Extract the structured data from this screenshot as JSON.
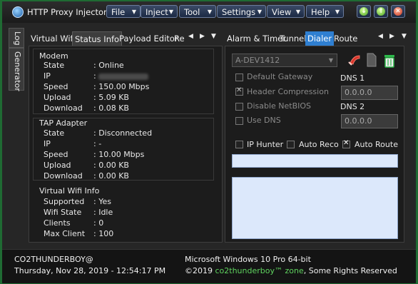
{
  "app": {
    "title": "HTTP Proxy Injector"
  },
  "menu": {
    "file": "File",
    "inject": "Inject",
    "tool": "Tool",
    "settings": "Settings",
    "view": "View",
    "help": "Help"
  },
  "window_buttons": [
    "down-arrow-icon",
    "up-arrow-icon",
    "close-icon"
  ],
  "side_tabs": [
    "Log",
    "Generator"
  ],
  "left_tabs": [
    "Virtual Wifi",
    "Status Info",
    "Payload Editor",
    "Rep"
  ],
  "right_tabs": [
    "Alarm & Timer",
    "Tunnel",
    "Dialer",
    "Route"
  ],
  "status": {
    "modem": {
      "title": "Modem",
      "rows": [
        {
          "label": "State",
          "value": ": Online"
        },
        {
          "label": "IP",
          "value": ":"
        },
        {
          "label": "Speed",
          "value": ": 150.00 Mbps"
        },
        {
          "label": "Upload",
          "value": ": 5.09 KB"
        },
        {
          "label": "Download",
          "value": ": 0.08 KB"
        }
      ]
    },
    "tap": {
      "title": "TAP Adapter",
      "rows": [
        {
          "label": "State",
          "value": ": Disconnected"
        },
        {
          "label": "IP",
          "value": ": -"
        },
        {
          "label": "Speed",
          "value": ": 10.00 Mbps"
        },
        {
          "label": "Upload",
          "value": ": 0.00 KB"
        },
        {
          "label": "Download",
          "value": ": 0.00 KB"
        }
      ]
    },
    "wifi": {
      "title": "Virtual Wifi Info",
      "rows": [
        {
          "label": "Supported",
          "value": ": Yes"
        },
        {
          "label": "Wifi State",
          "value": ": Idle"
        },
        {
          "label": "Clients",
          "value": ": 0"
        },
        {
          "label": "Max Client",
          "value": ": 100"
        }
      ]
    }
  },
  "dialer": {
    "device": "A-DEV1412",
    "default_gateway": "Default Gateway",
    "header_compression": "Header Compression",
    "disable_netbios": "Disable NetBIOS",
    "use_dns": "Use DNS",
    "dns1_label": "DNS 1",
    "dns1_value": "0.0.0.0",
    "dns2_label": "DNS 2",
    "dns2_value": "0.0.0.0",
    "ip_hunter": "IP Hunter",
    "auto_reco": "Auto Reco",
    "auto_route": "Auto Route"
  },
  "footer": {
    "user": "CO2THUNDERBOY@",
    "datetime": "Thursday, Nov 28, 2019 - 12:54:17 PM",
    "os": "Microsoft Windows 10 Pro 64-bit",
    "copyright_prefix": "©2019 ",
    "brand": "co2thunderboy™ zone",
    "copyright_suffix": ", Some Rights Reserved"
  },
  "colors": {
    "accent": "#2f7fd1",
    "window_border": "#1f6b33",
    "brand_green": "#5fd35f"
  }
}
